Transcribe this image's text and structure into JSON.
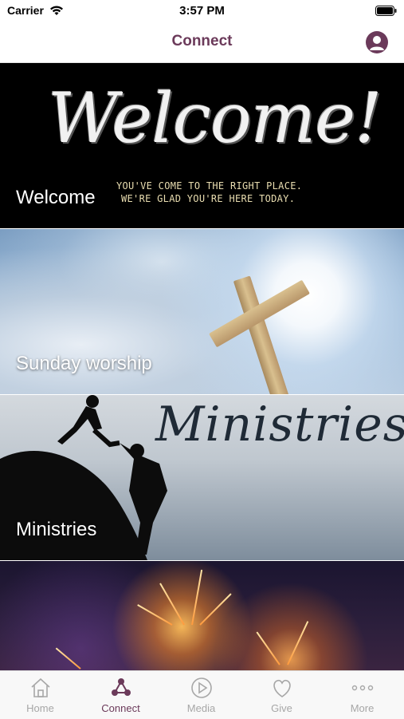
{
  "status_bar": {
    "carrier": "Carrier",
    "time": "3:57 PM"
  },
  "nav": {
    "title": "Connect",
    "profile_icon": "user-circle-icon"
  },
  "tiles": [
    {
      "label": "Welcome",
      "banner_text": "Welcome!",
      "subtext_1": "YOU'VE COME TO THE RIGHT PLACE.",
      "subtext_2": "WE'RE GLAD YOU'RE HERE TODAY."
    },
    {
      "label": "Sunday worship"
    },
    {
      "label": "Ministries",
      "banner_text": "Ministries"
    },
    {
      "label": ""
    }
  ],
  "tabbar": {
    "active": "Connect",
    "accent_color": "#6b3a5a",
    "inactive_color": "#a7a7a7",
    "items": [
      {
        "label": "Home",
        "icon": "home-icon"
      },
      {
        "label": "Connect",
        "icon": "connect-icon"
      },
      {
        "label": "Media",
        "icon": "play-circle-icon"
      },
      {
        "label": "Give",
        "icon": "heart-icon"
      },
      {
        "label": "More",
        "icon": "more-dots-icon"
      }
    ]
  }
}
